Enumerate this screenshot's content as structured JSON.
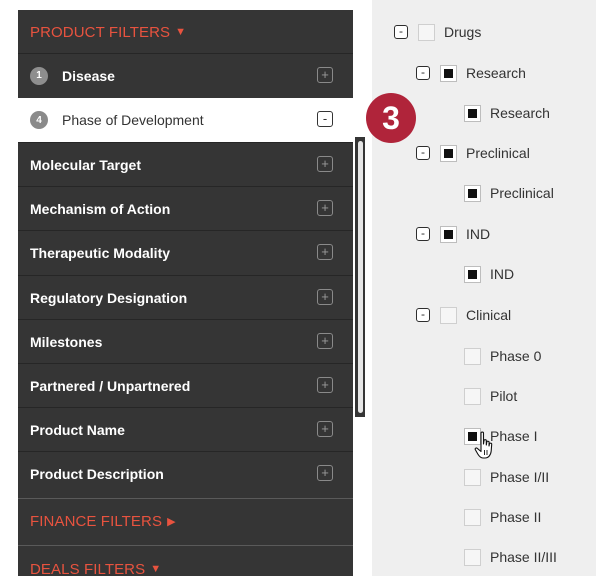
{
  "filters": {
    "product_title": "PRODUCT FILTERS",
    "finance_title": "FINANCE FILTERS",
    "deals_title": "DEALS FILTERS",
    "items": [
      {
        "num": "1",
        "label": "Disease",
        "toggle": "+"
      },
      {
        "num": "4",
        "label": "Phase of Development",
        "toggle": "-"
      },
      {
        "label": "Molecular Target",
        "toggle": "+"
      },
      {
        "label": "Mechanism of Action",
        "toggle": "+"
      },
      {
        "label": "Therapeutic Modality",
        "toggle": "+"
      },
      {
        "label": "Regulatory Designation",
        "toggle": "+"
      },
      {
        "label": "Milestones",
        "toggle": "+"
      },
      {
        "label": "Partnered / Unpartnered",
        "toggle": "+"
      },
      {
        "label": "Product Name",
        "toggle": "+"
      },
      {
        "label": "Product Description",
        "toggle": "+"
      }
    ]
  },
  "step_badge": "3",
  "tree": {
    "nodes": [
      {
        "label": "Drugs",
        "toggle": "-",
        "checked": false
      },
      {
        "label": "Research",
        "toggle": "-",
        "checked": true
      },
      {
        "label": "Research",
        "checked": true
      },
      {
        "label": "Preclinical",
        "toggle": "-",
        "checked": true
      },
      {
        "label": "Preclinical",
        "checked": true
      },
      {
        "label": "IND",
        "toggle": "-",
        "checked": true
      },
      {
        "label": "IND",
        "checked": true
      },
      {
        "label": "Clinical",
        "toggle": "-",
        "checked": false
      },
      {
        "label": "Phase 0",
        "checked": false
      },
      {
        "label": "Pilot",
        "checked": false
      },
      {
        "label": "Phase I",
        "checked": true
      },
      {
        "label": "Phase I/II",
        "checked": false
      },
      {
        "label": "Phase II",
        "checked": false
      },
      {
        "label": "Phase II/III",
        "checked": false
      }
    ]
  },
  "colors": {
    "accent": "#e8533f",
    "sidebar": "#353535",
    "badge": "#b0243a"
  }
}
